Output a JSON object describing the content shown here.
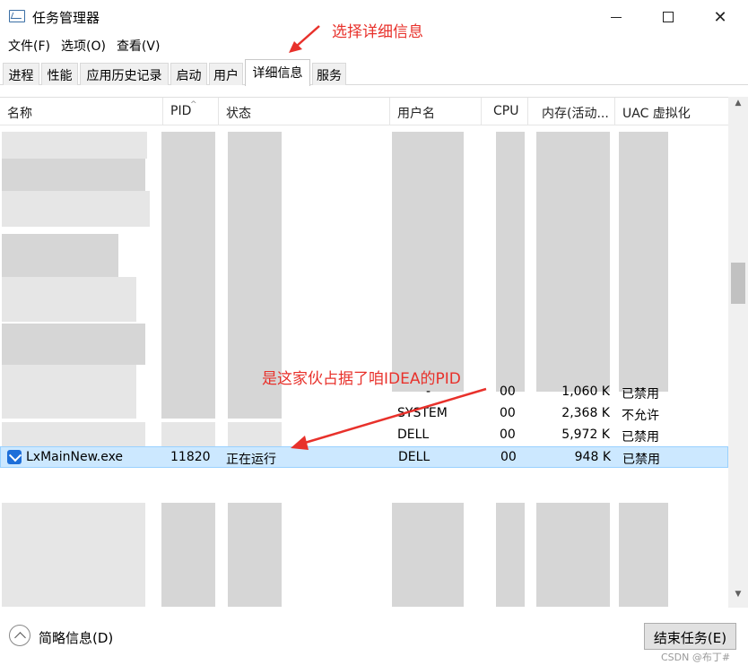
{
  "window": {
    "title": "任务管理器",
    "minimize": "",
    "maximize": "",
    "close": "✕"
  },
  "menu": [
    "文件(F)",
    "选项(O)",
    "查看(V)"
  ],
  "tabs": [
    "进程",
    "性能",
    "应用历史记录",
    "启动",
    "用户",
    "详细信息",
    "服务"
  ],
  "active_tab": "详细信息",
  "columns": [
    "名称",
    "PID",
    "状态",
    "用户名",
    "CPU",
    "内存(活动...",
    "UAC 虚拟化"
  ],
  "sort_indicator": "^",
  "rows": [
    {
      "name": "",
      "pid": "",
      "status": "",
      "user": "-",
      "cpu": "00",
      "mem": "1,060 K",
      "uac": "已禁用"
    },
    {
      "name": "",
      "pid": "",
      "status": "",
      "user": "SYSTEM",
      "cpu": "00",
      "mem": "2,368 K",
      "uac": "不允许"
    },
    {
      "name": "",
      "pid": "",
      "status": "",
      "user": "DELL",
      "cpu": "00",
      "mem": "5,972 K",
      "uac": "已禁用"
    }
  ],
  "selected_row": {
    "name": "LxMainNew.exe",
    "pid": "11820",
    "status": "正在运行",
    "user": "DELL",
    "cpu": "00",
    "mem": "948 K",
    "uac": "已禁用"
  },
  "annotations": {
    "tab_hint": "选择详细信息",
    "pid_hint": "是这家伙占据了咱IDEA的PID"
  },
  "footer": {
    "brief": "简略信息(D)",
    "end_task": "结束任务(E)",
    "watermark": "CSDN @布丁#"
  },
  "colors": {
    "annotation": "#e8312b",
    "selection": "#cce8ff"
  }
}
